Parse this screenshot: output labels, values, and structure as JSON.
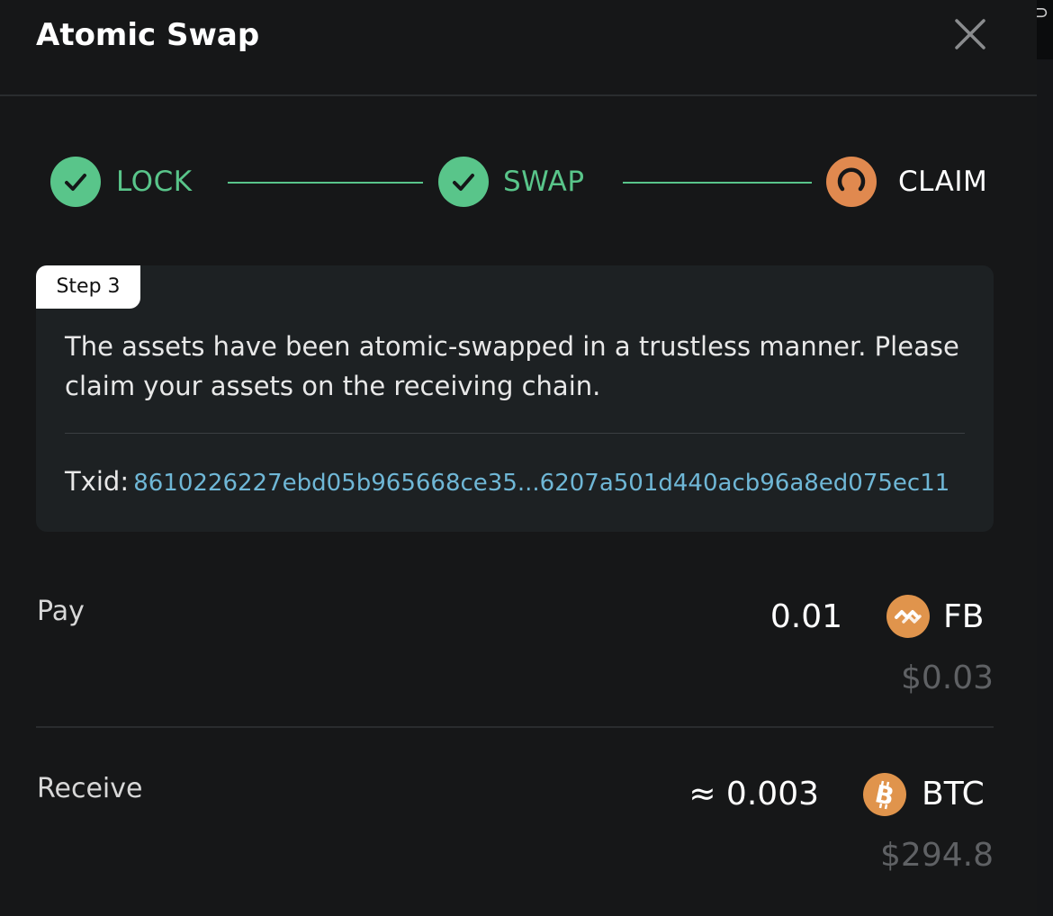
{
  "title": "Atomic Swap",
  "colors": {
    "background": "#161718",
    "card": "#1d2123",
    "success": "#59c58a",
    "pending": "#e0894f",
    "txid": "#6fb7d6",
    "muted": "#5f6164"
  },
  "steps": [
    {
      "label": "LOCK",
      "status": "done",
      "icon": "check-icon"
    },
    {
      "label": "SWAP",
      "status": "done",
      "icon": "check-icon"
    },
    {
      "label": "CLAIM",
      "status": "in-progress",
      "icon": "spinner-icon"
    }
  ],
  "card": {
    "badge": "Step 3",
    "message": "The assets have been atomic-swapped in a trustless manner. Please claim your assets on the receiving chain.",
    "txid_label": "Txid:",
    "txid_value": "8610226227ebd05b965668ce35...6207a501d440acb96a8ed075ec11"
  },
  "pay": {
    "label": "Pay",
    "amount": "0.01",
    "token": "FB",
    "token_icon": "fb-token-icon",
    "usd": "$0.03"
  },
  "receive": {
    "label": "Receive",
    "amount": "≈ 0.003",
    "token": "BTC",
    "token_icon": "bitcoin-icon",
    "usd": "$294.8"
  }
}
